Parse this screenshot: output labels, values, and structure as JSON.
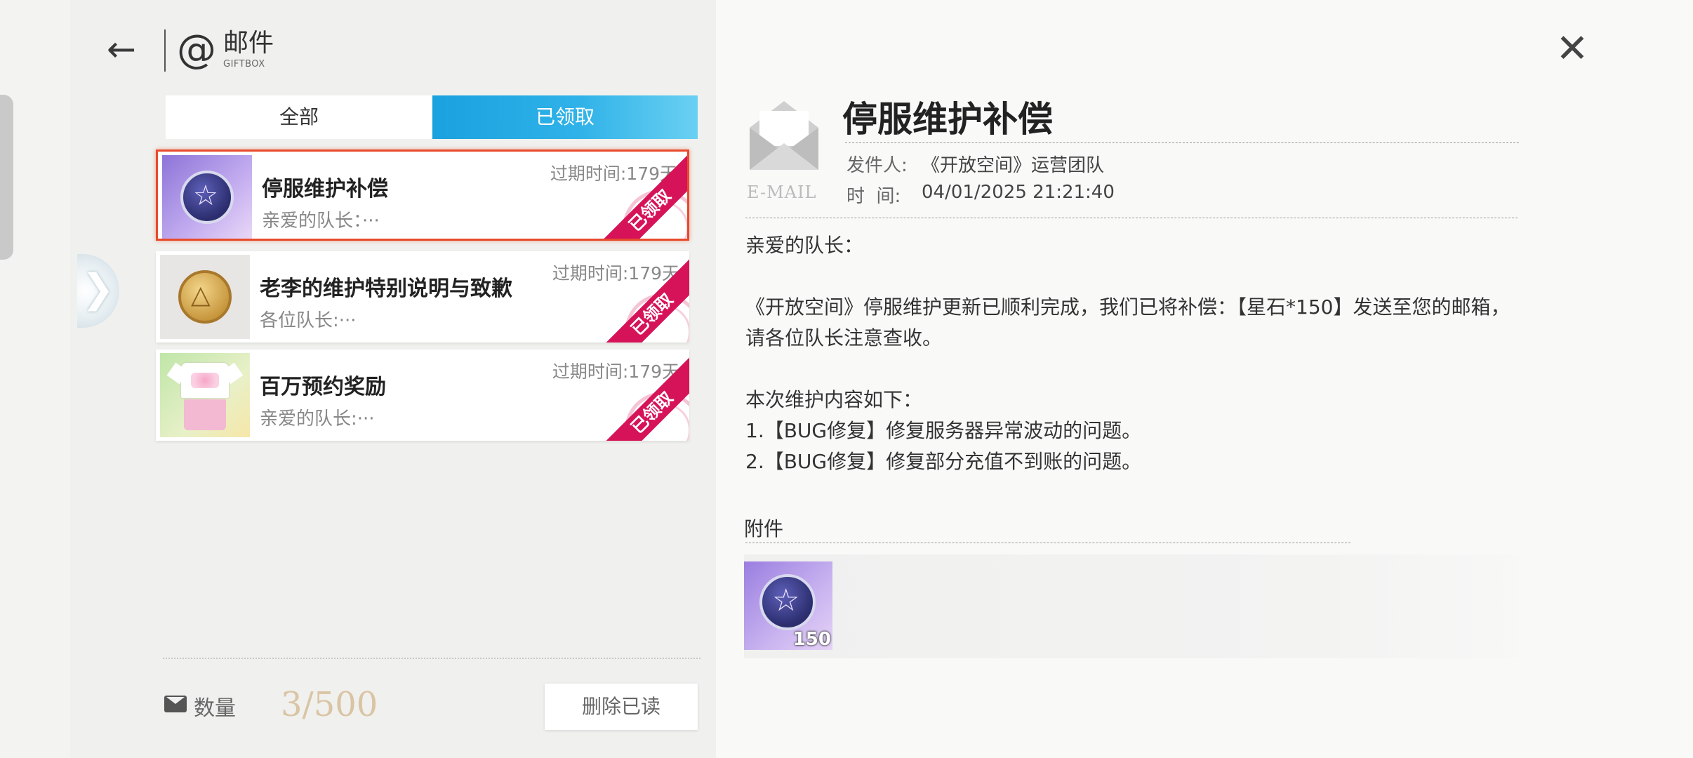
{
  "header": {
    "title": "邮件",
    "subtitle": "GIFTBOX"
  },
  "tabs": [
    {
      "label": "全部",
      "active": false
    },
    {
      "label": "已领取",
      "active": true
    }
  ],
  "mails": [
    {
      "title": "停服维护补偿",
      "preview": "亲爱的队长：···",
      "expire": "过期时间:179天",
      "status": "已领取",
      "icon": "star-coin-icon",
      "selected": true
    },
    {
      "title": "老李的维护特别说明与致歉",
      "preview": "各位队长:···",
      "expire": "过期时间:179天",
      "status": "已领取",
      "icon": "gold-coin-icon",
      "selected": false
    },
    {
      "title": "百万预约奖励",
      "preview": "亲爱的队长:···",
      "expire": "过期时间:179天",
      "status": "已领取",
      "icon": "outfit-icon",
      "selected": false
    }
  ],
  "footer": {
    "count_label": "数量",
    "count_value": "3/500",
    "delete_label": "删除已读"
  },
  "detail": {
    "email_label": "E-MAIL",
    "title": "停服维护补偿",
    "sender_label": "发件人:",
    "sender": "《开放空间》运营团队",
    "time_label": "时  间:",
    "time": "04/01/2025 21:21:40",
    "body": "亲爱的队长：\n\n《开放空间》停服维护更新已顺利完成，我们已将补偿：【星石*150】发送至您的邮箱，请各位队长注意查收。\n\n本次维护内容如下：\n1.【BUG修复】修复服务器异常波动的问题。\n2.【BUG修复】修复部分充值不到账的问题。",
    "attach_label": "附件",
    "attachments": [
      {
        "icon": "star-stone-icon",
        "qty": "150"
      }
    ]
  },
  "colors": {
    "accent_blue": "#1aa1df",
    "claimed_ribbon": "#d61358",
    "selected_border": "#e84a2b"
  }
}
